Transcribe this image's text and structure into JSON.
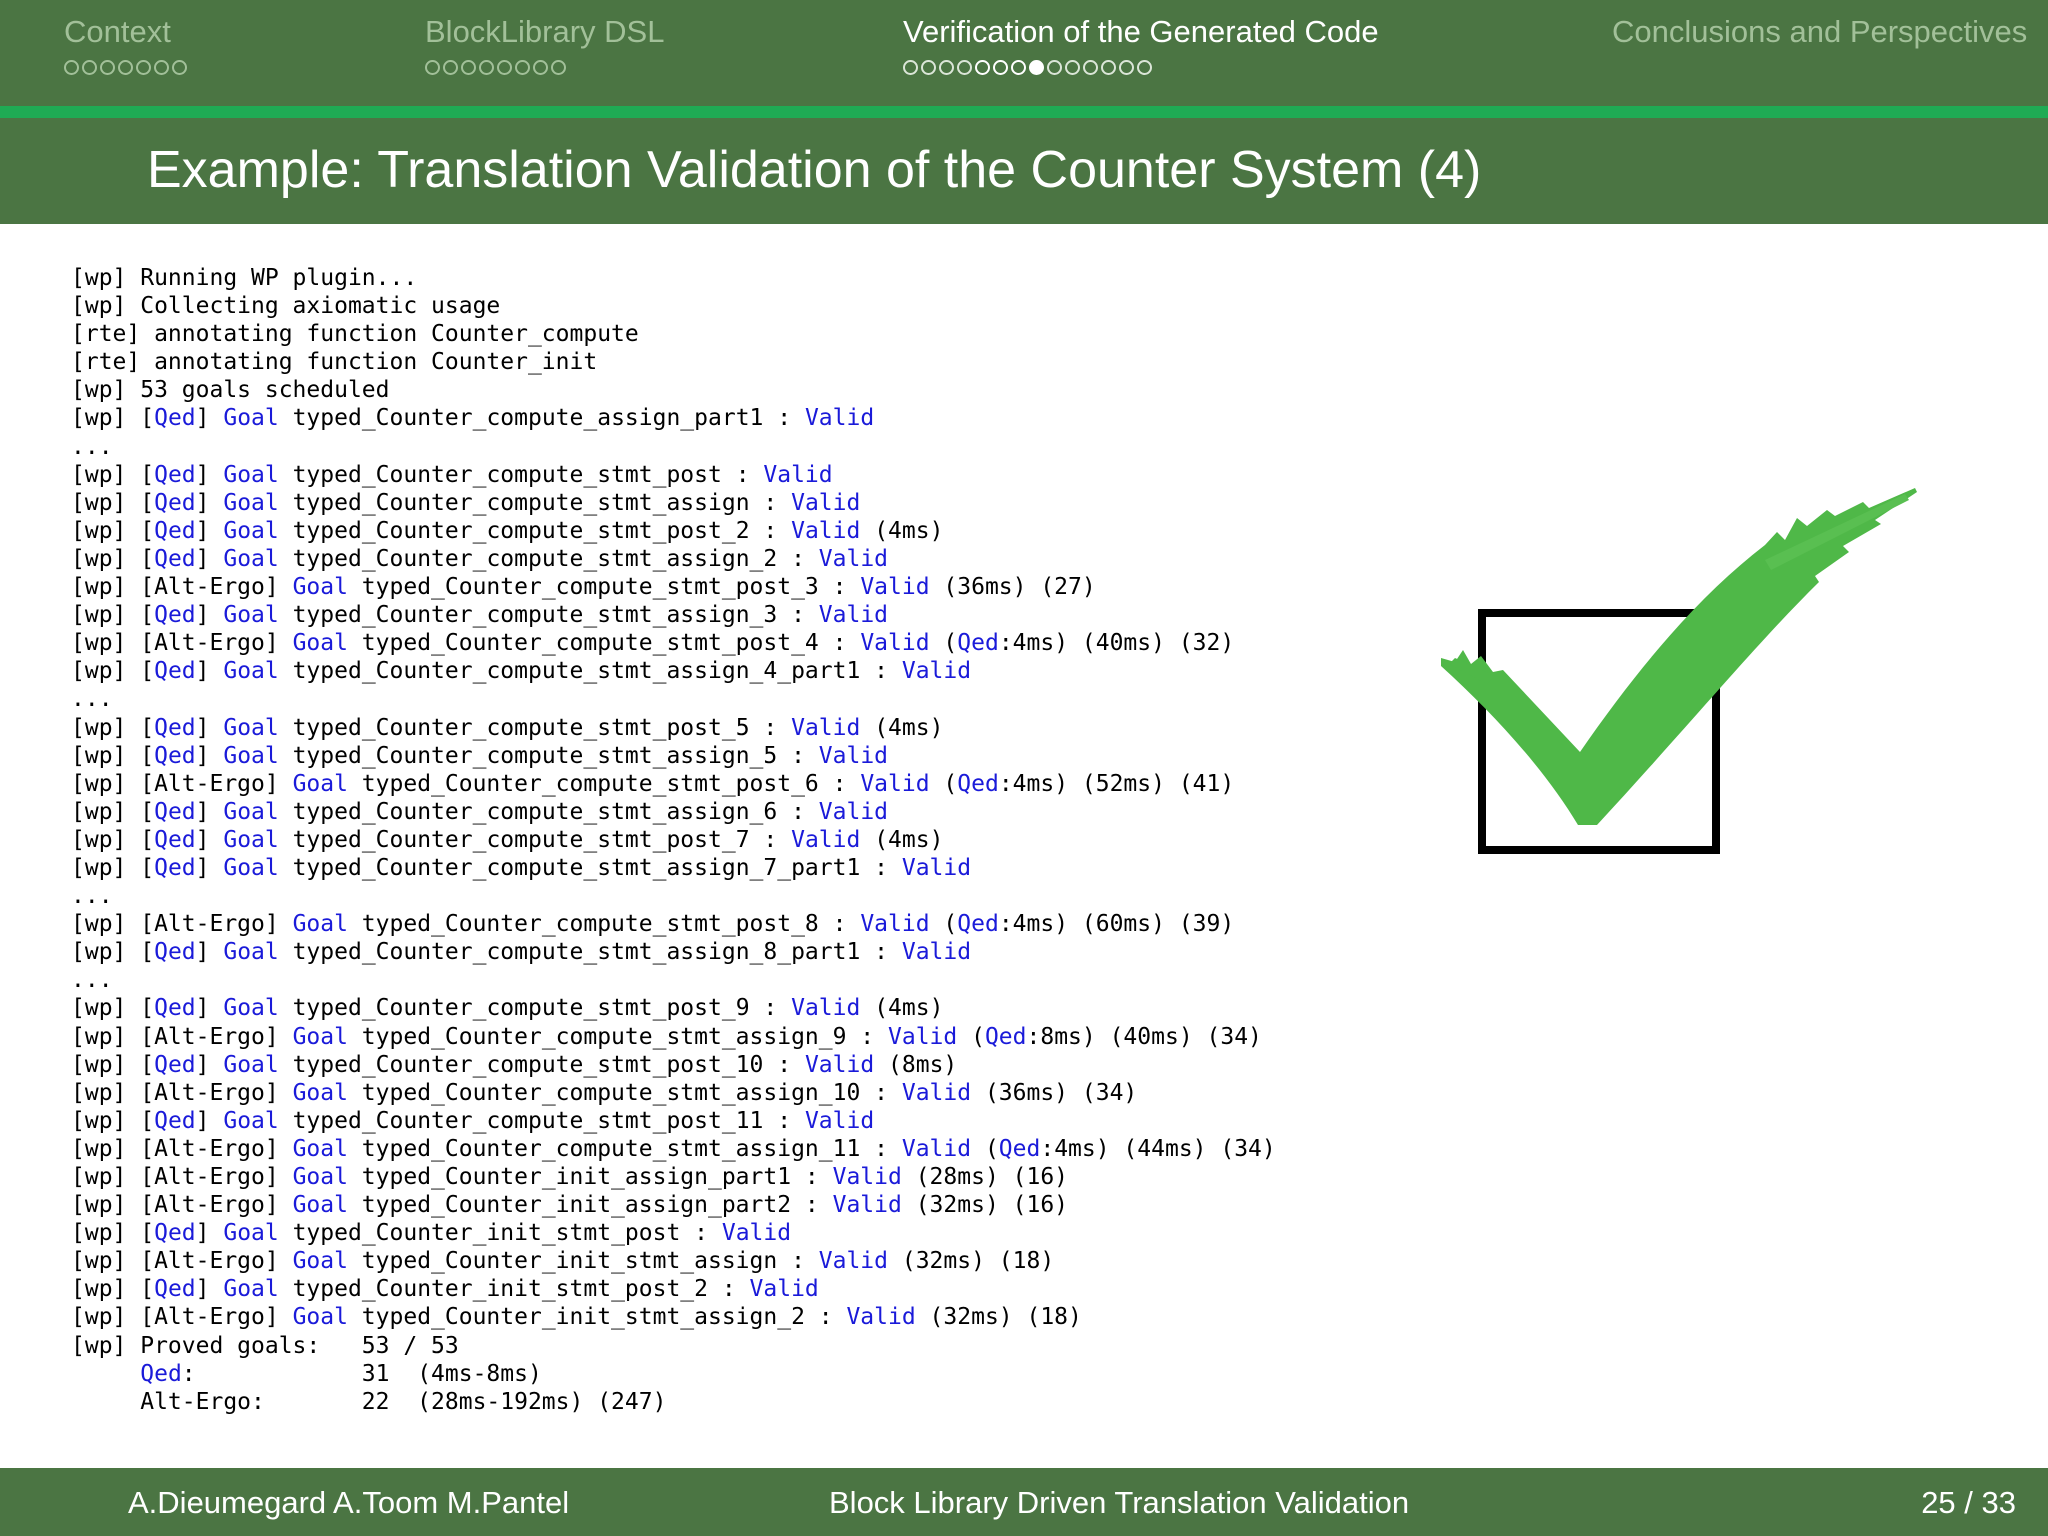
{
  "nav": {
    "sections": [
      {
        "label": "Context",
        "dots": 7,
        "current": -1,
        "bright_from": -1,
        "bright_to": -1,
        "active": false
      },
      {
        "label": "BlockLibrary DSL",
        "dots": 8,
        "current": -1,
        "bright_from": -1,
        "bright_to": -1,
        "active": false
      },
      {
        "label": "Verification of the Generated Code",
        "dots": 14,
        "current": 7,
        "bright_from": 4,
        "bright_to": 7,
        "active": true
      },
      {
        "label": "Conclusions and Perspectives",
        "dots": 0,
        "current": -1,
        "bright_from": -1,
        "bright_to": -1,
        "active": false
      }
    ]
  },
  "slide": {
    "title": "Example: Translation Validation of the Counter System (4)"
  },
  "log_lines": [
    [
      [
        "",
        "[wp] Running WP plugin..."
      ]
    ],
    [
      [
        "",
        "[wp] Collecting axiomatic usage"
      ]
    ],
    [
      [
        "",
        "[rte] annotating function Counter_compute"
      ]
    ],
    [
      [
        "",
        "[rte] annotating function Counter_init"
      ]
    ],
    [
      [
        "",
        "[wp] 53 goals scheduled"
      ]
    ],
    [
      [
        "",
        "[wp] ["
      ],
      [
        "kw",
        "Qed"
      ],
      [
        "",
        "] "
      ],
      [
        "kw",
        "Goal"
      ],
      [
        "",
        " typed_Counter_compute_assign_part1 : "
      ],
      [
        "kw",
        "Valid"
      ]
    ],
    [
      [
        "",
        "..."
      ]
    ],
    [
      [
        "",
        "[wp] ["
      ],
      [
        "kw",
        "Qed"
      ],
      [
        "",
        "] "
      ],
      [
        "kw",
        "Goal"
      ],
      [
        "",
        " typed_Counter_compute_stmt_post : "
      ],
      [
        "kw",
        "Valid"
      ]
    ],
    [
      [
        "",
        "[wp] ["
      ],
      [
        "kw",
        "Qed"
      ],
      [
        "",
        "] "
      ],
      [
        "kw",
        "Goal"
      ],
      [
        "",
        " typed_Counter_compute_stmt_assign : "
      ],
      [
        "kw",
        "Valid"
      ]
    ],
    [
      [
        "",
        "[wp] ["
      ],
      [
        "kw",
        "Qed"
      ],
      [
        "",
        "] "
      ],
      [
        "kw",
        "Goal"
      ],
      [
        "",
        " typed_Counter_compute_stmt_post_2 : "
      ],
      [
        "kw",
        "Valid"
      ],
      [
        "",
        " (4ms)"
      ]
    ],
    [
      [
        "",
        "[wp] ["
      ],
      [
        "kw",
        "Qed"
      ],
      [
        "",
        "] "
      ],
      [
        "kw",
        "Goal"
      ],
      [
        "",
        " typed_Counter_compute_stmt_assign_2 : "
      ],
      [
        "kw",
        "Valid"
      ]
    ],
    [
      [
        "",
        "[wp] [Alt-Ergo] "
      ],
      [
        "kw",
        "Goal"
      ],
      [
        "",
        " typed_Counter_compute_stmt_post_3 : "
      ],
      [
        "kw",
        "Valid"
      ],
      [
        "",
        " (36ms) (27)"
      ]
    ],
    [
      [
        "",
        "[wp] ["
      ],
      [
        "kw",
        "Qed"
      ],
      [
        "",
        "] "
      ],
      [
        "kw",
        "Goal"
      ],
      [
        "",
        " typed_Counter_compute_stmt_assign_3 : "
      ],
      [
        "kw",
        "Valid"
      ]
    ],
    [
      [
        "",
        "[wp] [Alt-Ergo] "
      ],
      [
        "kw",
        "Goal"
      ],
      [
        "",
        " typed_Counter_compute_stmt_post_4 : "
      ],
      [
        "kw",
        "Valid"
      ],
      [
        "",
        " ("
      ],
      [
        "kw",
        "Qed"
      ],
      [
        "",
        ":4ms) (40ms) (32)"
      ]
    ],
    [
      [
        "",
        "[wp] ["
      ],
      [
        "kw",
        "Qed"
      ],
      [
        "",
        "] "
      ],
      [
        "kw",
        "Goal"
      ],
      [
        "",
        " typed_Counter_compute_stmt_assign_4_part1 : "
      ],
      [
        "kw",
        "Valid"
      ]
    ],
    [
      [
        "",
        "..."
      ]
    ],
    [
      [
        "",
        "[wp] ["
      ],
      [
        "kw",
        "Qed"
      ],
      [
        "",
        "] "
      ],
      [
        "kw",
        "Goal"
      ],
      [
        "",
        " typed_Counter_compute_stmt_post_5 : "
      ],
      [
        "kw",
        "Valid"
      ],
      [
        "",
        " (4ms)"
      ]
    ],
    [
      [
        "",
        "[wp] ["
      ],
      [
        "kw",
        "Qed"
      ],
      [
        "",
        "] "
      ],
      [
        "kw",
        "Goal"
      ],
      [
        "",
        " typed_Counter_compute_stmt_assign_5 : "
      ],
      [
        "kw",
        "Valid"
      ]
    ],
    [
      [
        "",
        "[wp] [Alt-Ergo] "
      ],
      [
        "kw",
        "Goal"
      ],
      [
        "",
        " typed_Counter_compute_stmt_post_6 : "
      ],
      [
        "kw",
        "Valid"
      ],
      [
        "",
        " ("
      ],
      [
        "kw",
        "Qed"
      ],
      [
        "",
        ":4ms) (52ms) (41)"
      ]
    ],
    [
      [
        "",
        "[wp] ["
      ],
      [
        "kw",
        "Qed"
      ],
      [
        "",
        "] "
      ],
      [
        "kw",
        "Goal"
      ],
      [
        "",
        " typed_Counter_compute_stmt_assign_6 : "
      ],
      [
        "kw",
        "Valid"
      ]
    ],
    [
      [
        "",
        "[wp] ["
      ],
      [
        "kw",
        "Qed"
      ],
      [
        "",
        "] "
      ],
      [
        "kw",
        "Goal"
      ],
      [
        "",
        " typed_Counter_compute_stmt_post_7 : "
      ],
      [
        "kw",
        "Valid"
      ],
      [
        "",
        " (4ms)"
      ]
    ],
    [
      [
        "",
        "[wp] ["
      ],
      [
        "kw",
        "Qed"
      ],
      [
        "",
        "] "
      ],
      [
        "kw",
        "Goal"
      ],
      [
        "",
        " typed_Counter_compute_stmt_assign_7_part1 : "
      ],
      [
        "kw",
        "Valid"
      ]
    ],
    [
      [
        "",
        "..."
      ]
    ],
    [
      [
        "",
        "[wp] [Alt-Ergo] "
      ],
      [
        "kw",
        "Goal"
      ],
      [
        "",
        " typed_Counter_compute_stmt_post_8 : "
      ],
      [
        "kw",
        "Valid"
      ],
      [
        "",
        " ("
      ],
      [
        "kw",
        "Qed"
      ],
      [
        "",
        ":4ms) (60ms) (39)"
      ]
    ],
    [
      [
        "",
        "[wp] ["
      ],
      [
        "kw",
        "Qed"
      ],
      [
        "",
        "] "
      ],
      [
        "kw",
        "Goal"
      ],
      [
        "",
        " typed_Counter_compute_stmt_assign_8_part1 : "
      ],
      [
        "kw",
        "Valid"
      ]
    ],
    [
      [
        "",
        "..."
      ]
    ],
    [
      [
        "",
        "[wp] ["
      ],
      [
        "kw",
        "Qed"
      ],
      [
        "",
        "] "
      ],
      [
        "kw",
        "Goal"
      ],
      [
        "",
        " typed_Counter_compute_stmt_post_9 : "
      ],
      [
        "kw",
        "Valid"
      ],
      [
        "",
        " (4ms)"
      ]
    ],
    [
      [
        "",
        "[wp] [Alt-Ergo] "
      ],
      [
        "kw",
        "Goal"
      ],
      [
        "",
        " typed_Counter_compute_stmt_assign_9 : "
      ],
      [
        "kw",
        "Valid"
      ],
      [
        "",
        " ("
      ],
      [
        "kw",
        "Qed"
      ],
      [
        "",
        ":8ms) (40ms) (34)"
      ]
    ],
    [
      [
        "",
        "[wp] ["
      ],
      [
        "kw",
        "Qed"
      ],
      [
        "",
        "] "
      ],
      [
        "kw",
        "Goal"
      ],
      [
        "",
        " typed_Counter_compute_stmt_post_10 : "
      ],
      [
        "kw",
        "Valid"
      ],
      [
        "",
        " (8ms)"
      ]
    ],
    [
      [
        "",
        "[wp] [Alt-Ergo] "
      ],
      [
        "kw",
        "Goal"
      ],
      [
        "",
        " typed_Counter_compute_stmt_assign_10 : "
      ],
      [
        "kw",
        "Valid"
      ],
      [
        "",
        " (36ms) (34)"
      ]
    ],
    [
      [
        "",
        "[wp] ["
      ],
      [
        "kw",
        "Qed"
      ],
      [
        "",
        "] "
      ],
      [
        "kw",
        "Goal"
      ],
      [
        "",
        " typed_Counter_compute_stmt_post_11 : "
      ],
      [
        "kw",
        "Valid"
      ]
    ],
    [
      [
        "",
        "[wp] [Alt-Ergo] "
      ],
      [
        "kw",
        "Goal"
      ],
      [
        "",
        " typed_Counter_compute_stmt_assign_11 : "
      ],
      [
        "kw",
        "Valid"
      ],
      [
        "",
        " ("
      ],
      [
        "kw",
        "Qed"
      ],
      [
        "",
        ":4ms) (44ms) (34)"
      ]
    ],
    [
      [
        "",
        "[wp] [Alt-Ergo] "
      ],
      [
        "kw",
        "Goal"
      ],
      [
        "",
        " typed_Counter_init_assign_part1 : "
      ],
      [
        "kw",
        "Valid"
      ],
      [
        "",
        " (28ms) (16)"
      ]
    ],
    [
      [
        "",
        "[wp] [Alt-Ergo] "
      ],
      [
        "kw",
        "Goal"
      ],
      [
        "",
        " typed_Counter_init_assign_part2 : "
      ],
      [
        "kw",
        "Valid"
      ],
      [
        "",
        " (32ms) (16)"
      ]
    ],
    [
      [
        "",
        "[wp] ["
      ],
      [
        "kw",
        "Qed"
      ],
      [
        "",
        "] "
      ],
      [
        "kw",
        "Goal"
      ],
      [
        "",
        " typed_Counter_init_stmt_post : "
      ],
      [
        "kw",
        "Valid"
      ]
    ],
    [
      [
        "",
        "[wp] [Alt-Ergo] "
      ],
      [
        "kw",
        "Goal"
      ],
      [
        "",
        " typed_Counter_init_stmt_assign : "
      ],
      [
        "kw",
        "Valid"
      ],
      [
        "",
        " (32ms) (18)"
      ]
    ],
    [
      [
        "",
        "[wp] ["
      ],
      [
        "kw",
        "Qed"
      ],
      [
        "",
        "] "
      ],
      [
        "kw",
        "Goal"
      ],
      [
        "",
        " typed_Counter_init_stmt_post_2 : "
      ],
      [
        "kw",
        "Valid"
      ]
    ],
    [
      [
        "",
        "[wp] [Alt-Ergo] "
      ],
      [
        "kw",
        "Goal"
      ],
      [
        "",
        " typed_Counter_init_stmt_assign_2 : "
      ],
      [
        "kw",
        "Valid"
      ],
      [
        "",
        " (32ms) (18)"
      ]
    ],
    [
      [
        "",
        "[wp] Proved goals:   53 / 53"
      ]
    ],
    [
      [
        "",
        "     "
      ],
      [
        "kw",
        "Qed"
      ],
      [
        "",
        ":            31  (4ms-8ms)"
      ]
    ],
    [
      [
        "",
        "     Alt-Ergo:       22  (28ms-192ms) (247)"
      ]
    ]
  ],
  "icons": {
    "checkmark": "green-checkmark-in-box-icon"
  },
  "footer": {
    "authors": "A.Dieumegard A.Toom M.Pantel",
    "title": "Block Library Driven Translation Validation",
    "page": "25 / 33"
  },
  "colors": {
    "theme_green": "#4b7543",
    "accent_stripe": "#1fab54",
    "keyword_blue": "#1a1ad9",
    "check_green": "#4fb848"
  }
}
